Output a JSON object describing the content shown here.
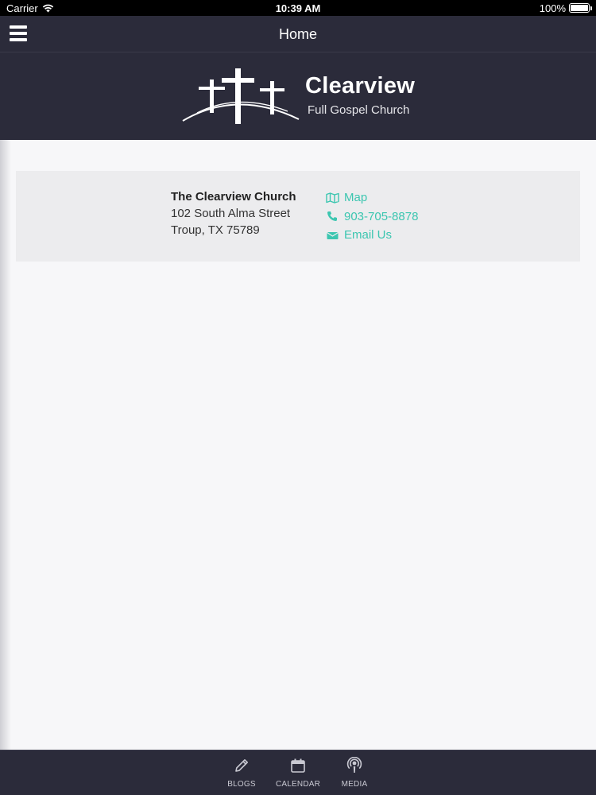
{
  "status_bar": {
    "carrier": "Carrier",
    "time": "10:39 AM",
    "battery_percent": "100%",
    "battery_level": 1.0
  },
  "nav": {
    "title": "Home",
    "menu_icon": "hamburger-menu-icon"
  },
  "logo": {
    "name": "Clearview",
    "subtitle": "Full Gospel Church",
    "mark_icon": "three-crosses-icon"
  },
  "info": {
    "name": "The Clearview Church",
    "address_line1": "102 South Alma Street",
    "address_line2": "Troup, TX 75789",
    "links": {
      "map": "Map",
      "phone": "903-705-8878",
      "email": "Email Us"
    }
  },
  "tabs": {
    "blogs": "BLOGS",
    "calendar": "CALENDAR",
    "media": "MEDIA"
  },
  "colors": {
    "nav_background": "#2b2b3a",
    "accent": "#3cc6b0",
    "content_background": "#f7f7f9",
    "card_background": "#ececee"
  }
}
